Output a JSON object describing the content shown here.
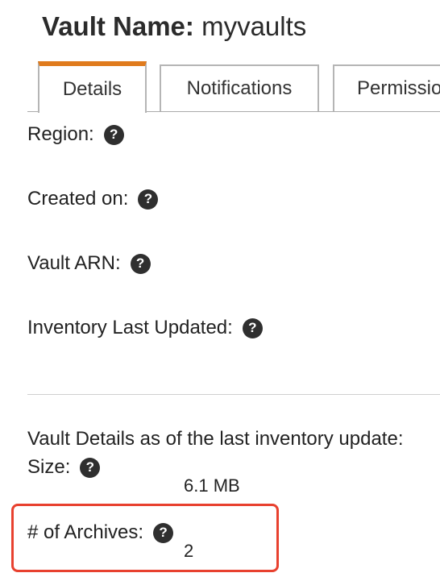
{
  "header": {
    "title_label": "Vault Name:",
    "vault_name": "myvaults"
  },
  "tabs": [
    {
      "label": "Details",
      "active": true
    },
    {
      "label": "Notifications",
      "active": false
    },
    {
      "label": "Permissions",
      "active": false
    }
  ],
  "details": {
    "region_label": "Region:",
    "created_label": "Created on:",
    "arn_label": "Vault ARN:",
    "inventory_label": "Inventory Last Updated:"
  },
  "inventory_details": {
    "heading": "Vault Details as of the last inventory update:",
    "size_label": "Size:",
    "size_value": "6.1 MB",
    "archives_label": "# of Archives:",
    "archives_value": "2"
  },
  "help_glyph": "?",
  "colors": {
    "active_tab_accent": "#e07b1d",
    "highlight": "#e8412f"
  }
}
